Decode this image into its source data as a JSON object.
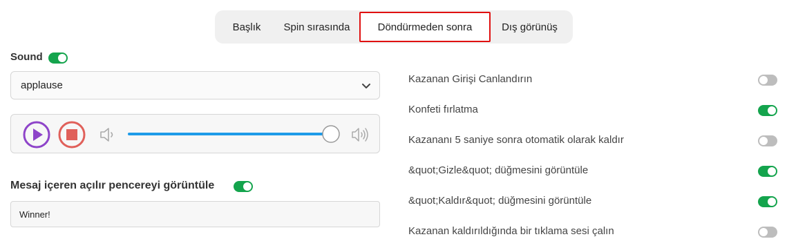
{
  "tabs": [
    {
      "label": "Başlık",
      "active": false
    },
    {
      "label": "Spin sırasında",
      "active": false
    },
    {
      "label": "Döndürmeden sonra",
      "active": true
    },
    {
      "label": "Dış görünüş",
      "active": false
    }
  ],
  "sound": {
    "label": "Sound",
    "enabled": true,
    "selected": "applause",
    "volume_fraction": 0.99
  },
  "popup": {
    "label": "Mesaj içeren açılır pencereyi görüntüle",
    "enabled": true,
    "message_value": "Winner!"
  },
  "settings": [
    {
      "label": "Kazanan Girişi Canlandırın",
      "on": false
    },
    {
      "label": "Konfeti fırlatma",
      "on": true
    },
    {
      "label": "Kazananı 5 saniye sonra otomatik olarak kaldır",
      "on": false
    },
    {
      "label": "&quot;Gizle&quot; düğmesini görüntüle",
      "on": true
    },
    {
      "label": "&quot;Kaldır&quot; düğmesini görüntüle",
      "on": true
    },
    {
      "label": "Kazanan kaldırıldığında bir tıklama sesi çalın",
      "on": false
    }
  ],
  "colors": {
    "toggle_on": "#14a44d",
    "toggle_off": "#bdbdbd",
    "play": "#8e44c9",
    "stop": "#e0605a",
    "slider": "#1e9be9",
    "highlight_border": "#e01010"
  }
}
